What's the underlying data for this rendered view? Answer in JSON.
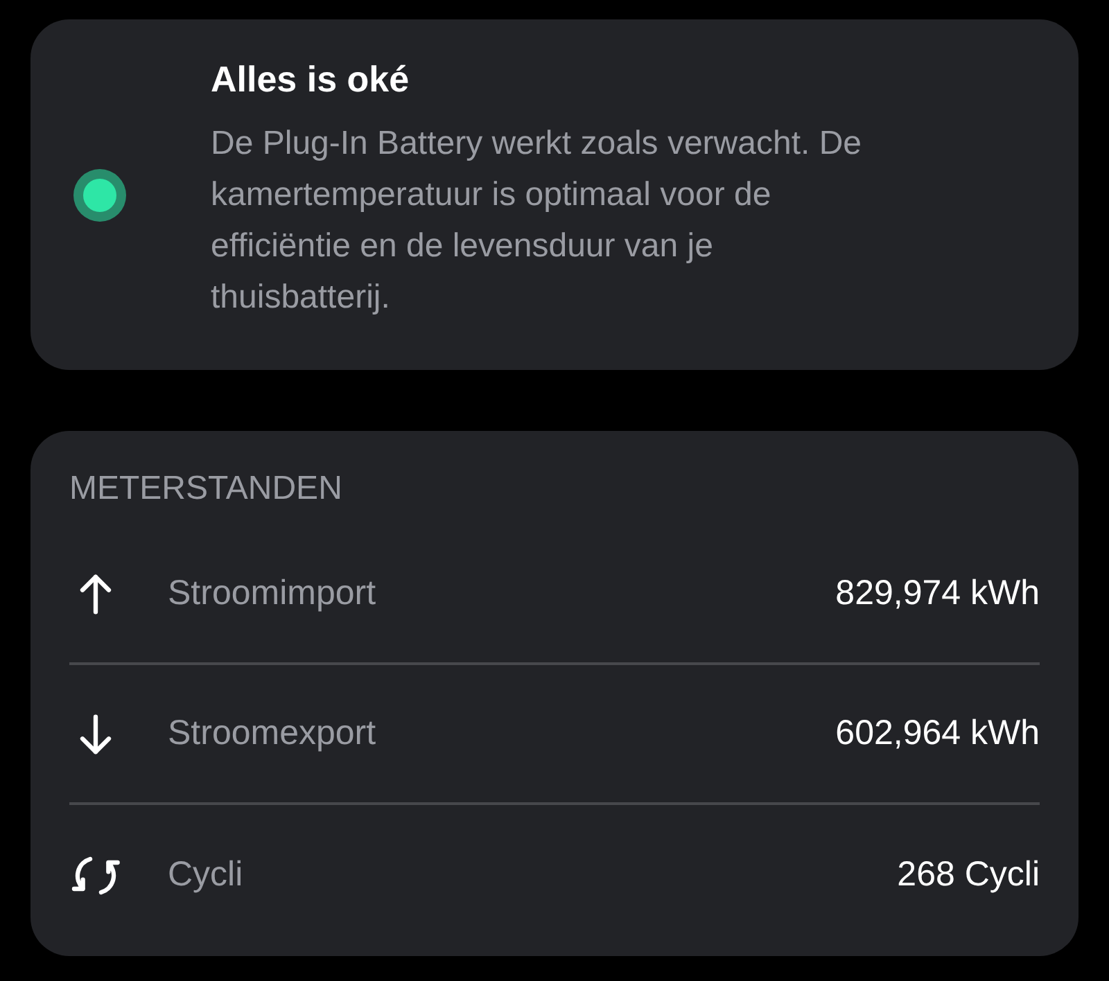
{
  "status": {
    "title": "Alles is oké",
    "message": "De Plug-In Battery werkt zoals verwacht. De kamertemperatuur is optimaal voor de efficiëntie en de levensduur van je thuisbatterij.",
    "color": "#2ee6a6"
  },
  "meters": {
    "heading": "METERSTANDEN",
    "rows": [
      {
        "kind": "up",
        "label": "Stroomimport",
        "value": "829,974 kWh"
      },
      {
        "kind": "down",
        "label": "Stroomexport",
        "value": "602,964 kWh"
      },
      {
        "kind": "cycle",
        "label": "Cycli",
        "value": "268 Cycli"
      }
    ]
  }
}
